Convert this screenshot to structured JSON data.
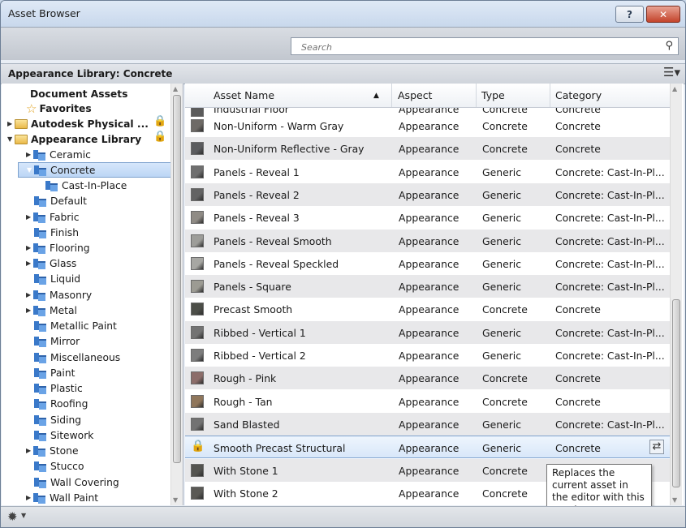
{
  "window": {
    "title": "Asset Browser",
    "help_label": "?",
    "close_label": "✕"
  },
  "search": {
    "placeholder": "Search"
  },
  "library_header": {
    "title": "Appearance Library: Concrete"
  },
  "tree": [
    {
      "label": "Document Assets",
      "bold": true
    },
    {
      "label": "Favorites",
      "bold": true
    },
    {
      "label": "Autodesk Physical ...",
      "bold": true
    },
    {
      "label": "Appearance Library",
      "bold": true
    },
    {
      "label": "Ceramic"
    },
    {
      "label": "Concrete",
      "selected": true
    },
    {
      "label": "Cast-In-Place"
    },
    {
      "label": "Default"
    },
    {
      "label": "Fabric"
    },
    {
      "label": "Finish"
    },
    {
      "label": "Flooring"
    },
    {
      "label": "Glass"
    },
    {
      "label": "Liquid"
    },
    {
      "label": "Masonry"
    },
    {
      "label": "Metal"
    },
    {
      "label": "Metallic Paint"
    },
    {
      "label": "Mirror"
    },
    {
      "label": "Miscellaneous"
    },
    {
      "label": "Paint"
    },
    {
      "label": "Plastic"
    },
    {
      "label": "Roofing"
    },
    {
      "label": "Siding"
    },
    {
      "label": "Sitework"
    },
    {
      "label": "Stone"
    },
    {
      "label": "Stucco"
    },
    {
      "label": "Wall Covering"
    },
    {
      "label": "Wall Paint"
    }
  ],
  "table": {
    "columns": [
      "Asset Name",
      "Aspect",
      "Type",
      "Category"
    ],
    "sort_indicator": "▲",
    "partial_row": {
      "name": "Industrial Floor",
      "aspect": "Appearance",
      "type": "Concrete",
      "category": "Concrete"
    },
    "rows": [
      {
        "name": "Non-Uniform - Warm Gray",
        "aspect": "Appearance",
        "type": "Concrete",
        "category": "Concrete",
        "color": "#6e6a66"
      },
      {
        "name": "Non-Uniform Reflective - Gray",
        "aspect": "Appearance",
        "type": "Concrete",
        "category": "Concrete",
        "color": "#5b5c5e"
      },
      {
        "name": "Panels - Reveal 1",
        "aspect": "Appearance",
        "type": "Generic",
        "category": "Concrete: Cast-In-Pl...",
        "color": "#6f6f6f"
      },
      {
        "name": "Panels - Reveal 2",
        "aspect": "Appearance",
        "type": "Generic",
        "category": "Concrete: Cast-In-Pl...",
        "color": "#636363"
      },
      {
        "name": "Panels - Reveal 3",
        "aspect": "Appearance",
        "type": "Generic",
        "category": "Concrete: Cast-In-Pl...",
        "color": "#8f8b85"
      },
      {
        "name": "Panels - Reveal Smooth",
        "aspect": "Appearance",
        "type": "Generic",
        "category": "Concrete: Cast-In-Pl...",
        "color": "#9d9d99"
      },
      {
        "name": "Panels - Reveal Speckled",
        "aspect": "Appearance",
        "type": "Generic",
        "category": "Concrete: Cast-In-Pl...",
        "color": "#a7a7a3"
      },
      {
        "name": "Panels - Square",
        "aspect": "Appearance",
        "type": "Generic",
        "category": "Concrete: Cast-In-Pl...",
        "color": "#9c9b93"
      },
      {
        "name": "Precast Smooth",
        "aspect": "Appearance",
        "type": "Concrete",
        "category": "Concrete",
        "color": "#4c4e48"
      },
      {
        "name": "Ribbed - Vertical 1",
        "aspect": "Appearance",
        "type": "Generic",
        "category": "Concrete: Cast-In-Pl...",
        "color": "#737373"
      },
      {
        "name": "Ribbed - Vertical 2",
        "aspect": "Appearance",
        "type": "Generic",
        "category": "Concrete: Cast-In-Pl...",
        "color": "#7d7d7d"
      },
      {
        "name": "Rough - Pink",
        "aspect": "Appearance",
        "type": "Concrete",
        "category": "Concrete",
        "color": "#8c6d6a"
      },
      {
        "name": "Rough - Tan",
        "aspect": "Appearance",
        "type": "Concrete",
        "category": "Concrete",
        "color": "#8f765b"
      },
      {
        "name": "Sand Blasted",
        "aspect": "Appearance",
        "type": "Generic",
        "category": "Concrete: Cast-In-Pl...",
        "color": "#727272"
      },
      {
        "name": "Smooth Precast Structural",
        "aspect": "Appearance",
        "type": "Generic",
        "category": "Concrete",
        "locked": true,
        "selected": true
      },
      {
        "name": "With Stone 1",
        "aspect": "Appearance",
        "type": "Concrete",
        "category": "Concrete",
        "color": "#545450"
      },
      {
        "name": "With Stone 2",
        "aspect": "Appearance",
        "type": "Concrete",
        "category": "Concrete",
        "color": "#5a5955"
      }
    ]
  },
  "tooltip": {
    "text": "Replaces the current asset in the editor with this asset."
  },
  "icons": {
    "search": "search-icon",
    "list_view": "list-view-icon",
    "gear": "gear-icon",
    "lock": "lock-icon",
    "replace": "replace-icon"
  }
}
